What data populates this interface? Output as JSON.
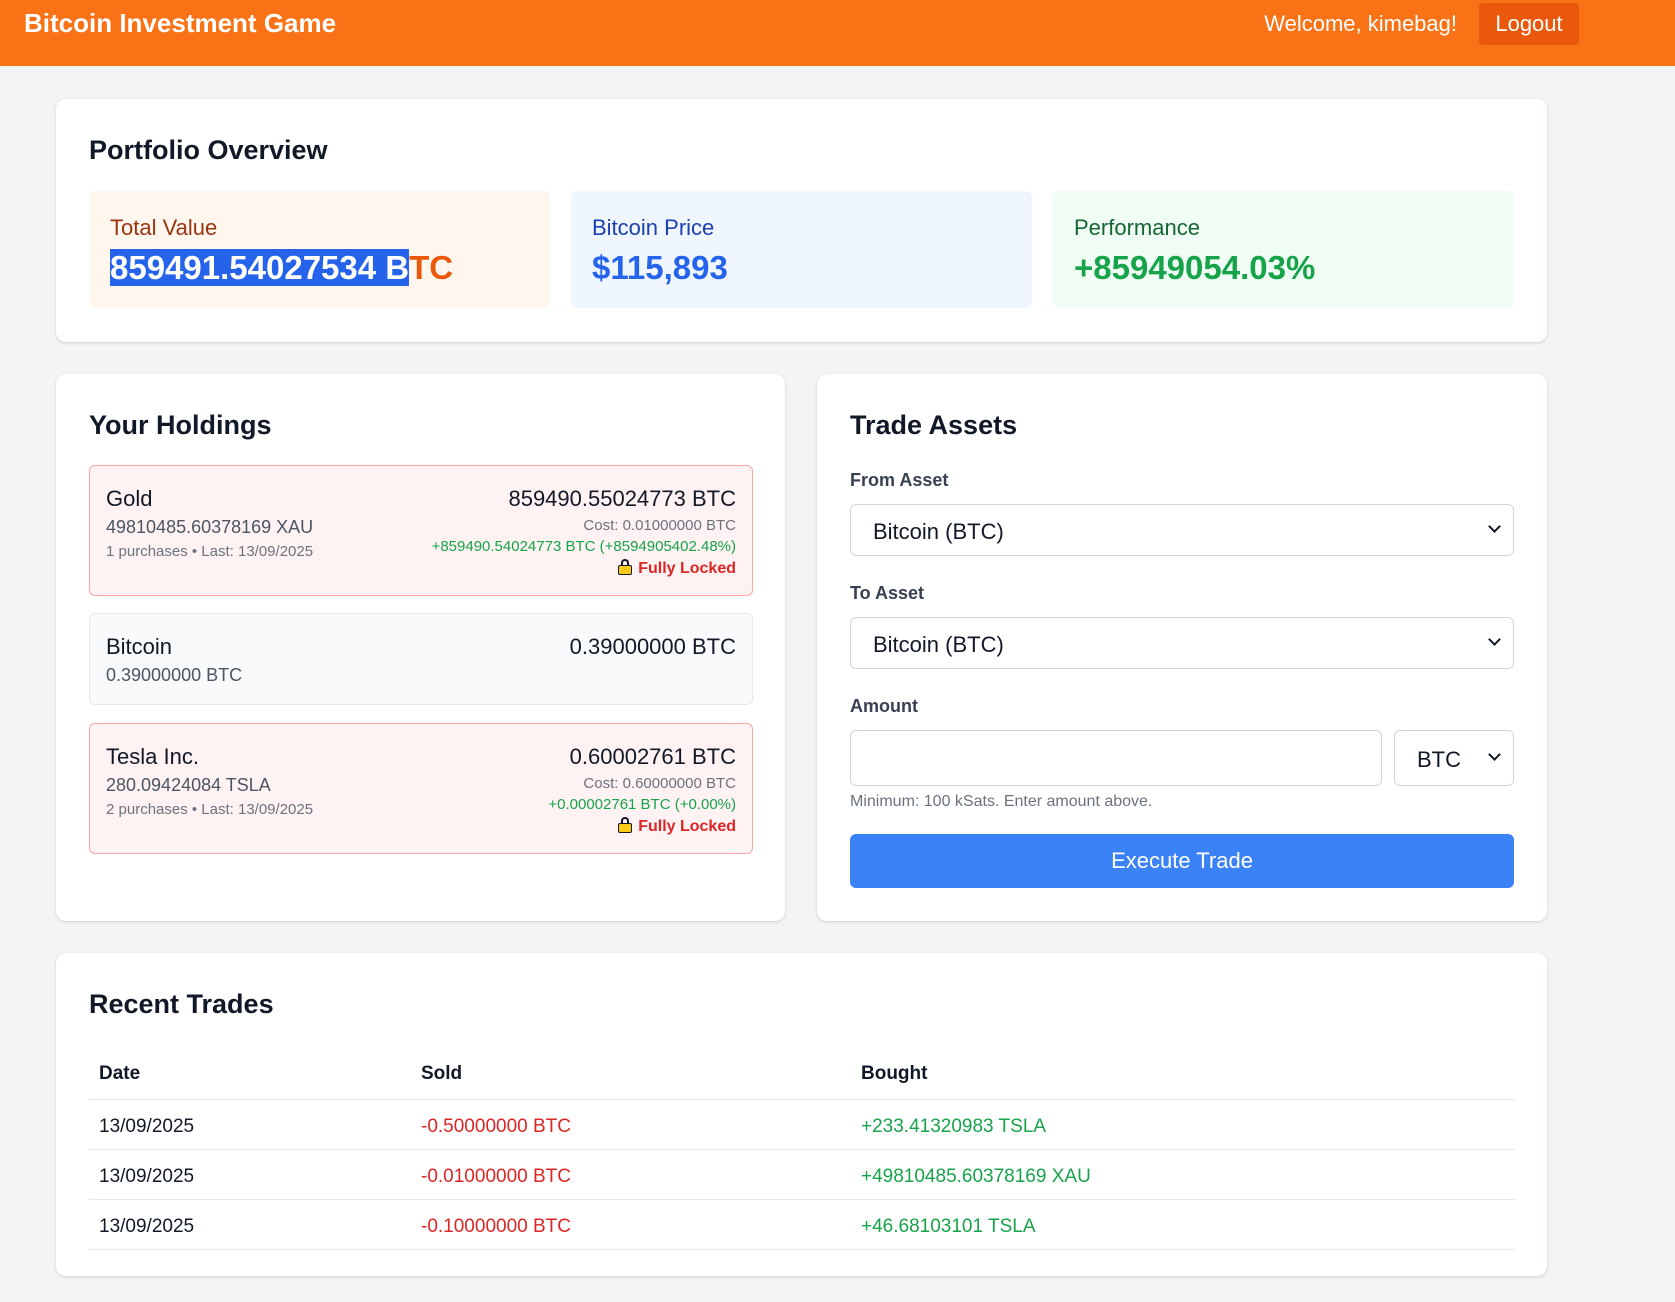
{
  "header": {
    "title": "Bitcoin Investment Game",
    "welcome": "Welcome, kimebag!",
    "logout_label": "Logout"
  },
  "overview": {
    "title": "Portfolio Overview",
    "total_label": "Total Value",
    "total_value_selected": "859491.54027534 B",
    "total_value_rest": "TC",
    "btc_label": "Bitcoin Price",
    "btc_value": "$115,893",
    "perf_label": "Performance",
    "perf_value": "+85949054.03%"
  },
  "holdings": {
    "title": "Your Holdings",
    "items": [
      {
        "name": "Gold",
        "quantity": "49810485.60378169 XAU",
        "meta": "1 purchases • Last: 13/09/2025",
        "value": "859490.55024773 BTC",
        "cost": "Cost: 0.01000000 BTC",
        "gain": "+859490.54024773 BTC (+8594905402.48%)",
        "lock": "Fully Locked"
      },
      {
        "name": "Bitcoin",
        "quantity": "0.39000000 BTC",
        "value": "0.39000000 BTC"
      },
      {
        "name": "Tesla Inc.",
        "quantity": "280.09424084 TSLA",
        "meta": "2 purchases • Last: 13/09/2025",
        "value": "0.60002761 BTC",
        "cost": "Cost: 0.60000000 BTC",
        "gain": "+0.00002761 BTC (+0.00%)",
        "lock": "Fully Locked"
      }
    ]
  },
  "trade": {
    "title": "Trade Assets",
    "from_label": "From Asset",
    "from_value": "Bitcoin (BTC)",
    "to_label": "To Asset",
    "to_value": "Bitcoin (BTC)",
    "amount_label": "Amount",
    "amount_value": "",
    "unit_value": "BTC",
    "help": "Minimum: 100 kSats. Enter amount above.",
    "execute_label": "Execute Trade"
  },
  "trades": {
    "title": "Recent Trades",
    "columns": [
      "Date",
      "Sold",
      "Bought"
    ],
    "rows": [
      {
        "date": "13/09/2025",
        "sold": "-0.50000000 BTC",
        "bought": "+233.41320983 TSLA"
      },
      {
        "date": "13/09/2025",
        "sold": "-0.01000000 BTC",
        "bought": "+49810485.60378169 XAU"
      },
      {
        "date": "13/09/2025",
        "sold": "-0.10000000 BTC",
        "bought": "+46.68103101 TSLA"
      }
    ]
  },
  "colors": {
    "brand": "#f97316",
    "logout": "#ea580c",
    "accent_blue": "#3b82f6",
    "positive": "#16a34a",
    "negative": "#dc2626",
    "locked_bg": "#fef2f2"
  },
  "icons": {
    "lock": "lock-icon",
    "dropdown": "chevron-down-icon"
  }
}
